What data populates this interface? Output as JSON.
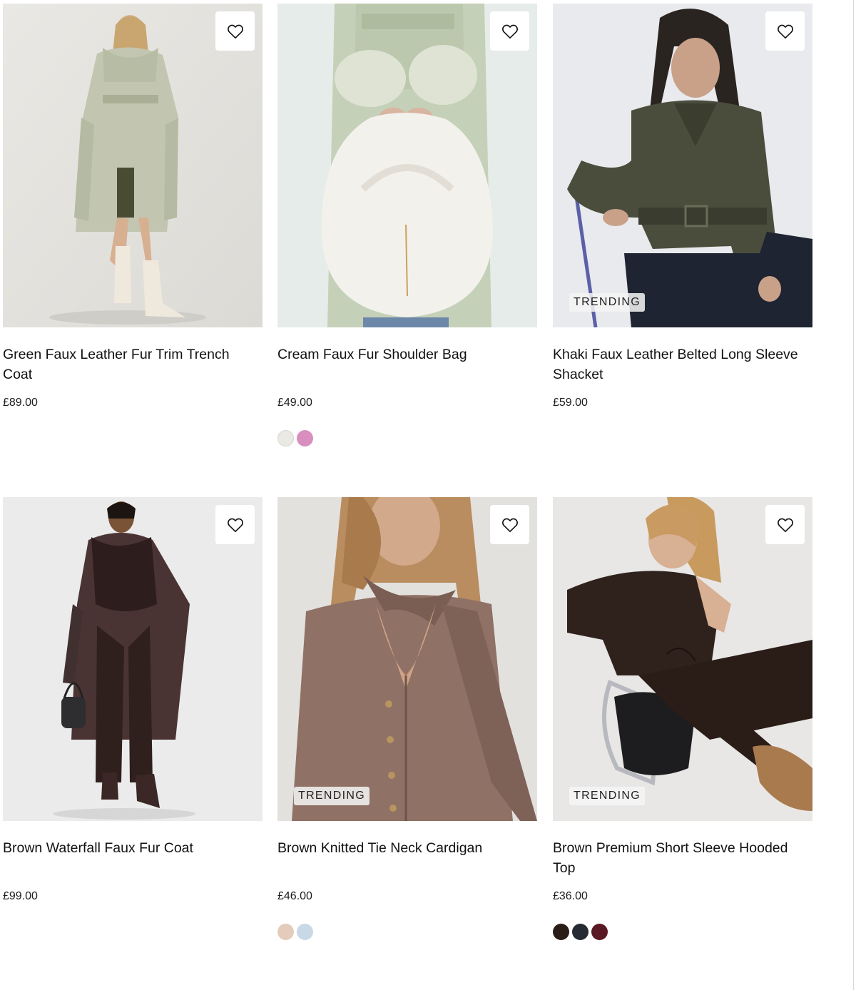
{
  "labels": {
    "trending_badge": "TRENDING"
  },
  "products": [
    {
      "name": "Green Faux Leather Fur Trim Trench Coat",
      "price": "£89.00",
      "badge": "",
      "image_subject": "model-in-sage-faux-leather-trench-coat",
      "swatches": []
    },
    {
      "name": "Cream Faux Fur Shoulder Bag",
      "price": "£49.00",
      "badge": "",
      "image_subject": "cream-shaggy-faux-fur-shoulder-bag",
      "swatches": [
        {
          "color": "#ebe9e3"
        },
        {
          "color": "#d88fc0"
        }
      ]
    },
    {
      "name": "Khaki Faux Leather Belted Long Sleeve Shacket",
      "price": "£59.00",
      "badge": "TRENDING",
      "image_subject": "model-seated-in-khaki-belted-leather-shacket",
      "swatches": []
    },
    {
      "name": "Brown Waterfall Faux Fur Coat",
      "price": "£99.00",
      "badge": "",
      "image_subject": "model-in-brown-faux-fur-collar-coat",
      "swatches": []
    },
    {
      "name": "Brown Knitted Tie Neck Cardigan",
      "price": "£46.00",
      "badge": "TRENDING",
      "image_subject": "model-in-taupe-knitted-tie-neck-cardigan",
      "swatches": [
        {
          "color": "#e4cbbb"
        },
        {
          "color": "#c9d8e6"
        }
      ]
    },
    {
      "name": "Brown Premium Short Sleeve Hooded Top",
      "price": "£36.00",
      "badge": "TRENDING",
      "image_subject": "model-seated-in-brown-short-sleeve-hoodie",
      "swatches": [
        {
          "color": "#2a1c17"
        },
        {
          "color": "#262a33"
        },
        {
          "color": "#5a1824"
        }
      ]
    }
  ],
  "theme": {
    "text": "#111111",
    "badge_bg": "#f2f2f2",
    "wishlist_bg": "#ffffff"
  }
}
